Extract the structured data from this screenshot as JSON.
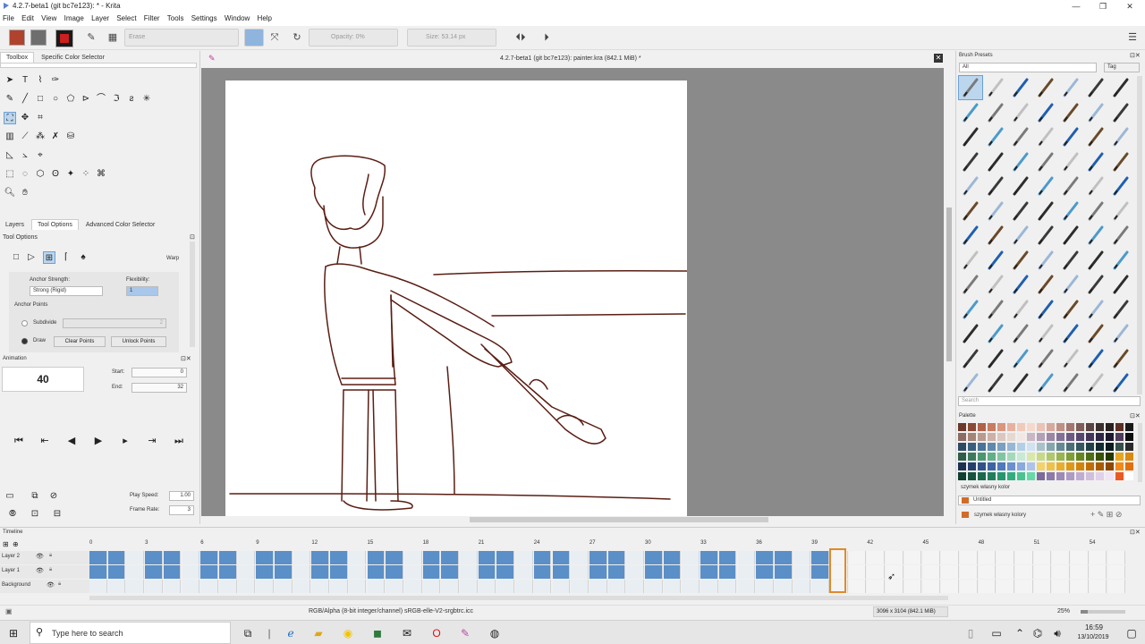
{
  "window": {
    "title": "4.2.7-beta1 (git bc7e123): * - Krita",
    "minimize": "—",
    "maximize": "❐",
    "close": "✕"
  },
  "menu": [
    "File",
    "Edit",
    "View",
    "Image",
    "Layer",
    "Select",
    "Filter",
    "Tools",
    "Settings",
    "Window",
    "Help"
  ],
  "toolbar": {
    "blend_mode": "Erase",
    "opacity": "Opacity: 0%",
    "size": "Size: 53.14 px",
    "colors": {
      "fg": "#b0432e",
      "bg": "#6e6e6e"
    }
  },
  "left_tabs": [
    "Toolbox",
    "Specific Color Selector"
  ],
  "lower_tabs": [
    "Layers",
    "Tool Options",
    "Advanced Color Selector"
  ],
  "tool_options": {
    "header": "Tool Options",
    "warp": "Warp",
    "anchor_strength_label": "Anchor Strength:",
    "anchor_strength_value": "Strong (Rigid)",
    "flexibility_label": "Flexibility:",
    "flexibility_value": "1",
    "anchor_points_label": "Anchor Points",
    "subdivide_label": "Subdivide",
    "subdivide_value": "2",
    "draw_label": "Draw",
    "clear_points": "Clear Points",
    "unlock_points": "Unlock Points"
  },
  "animation": {
    "header": "Animation",
    "current_frame": "40",
    "start_label": "Start:",
    "start_value": "0",
    "end_label": "End:",
    "end_value": "32",
    "play_speed_label": "Play Speed:",
    "play_speed_value": "1.00",
    "frame_rate_label": "Frame Rate:",
    "frame_rate_value": "3"
  },
  "canvas": {
    "header": "4.2.7-beta1 (git bc7e123): painter.kra (842.1 MiB) *"
  },
  "brush_presets": {
    "header": "Brush Presets",
    "filter": "All",
    "tag": "Tag",
    "search_placeholder": "Search"
  },
  "palette": {
    "header": "Palette",
    "name": "szymek własny kolor",
    "untitled": "Untitled",
    "entry": "szymek własny kolory"
  },
  "timeline": {
    "header": "Timeline",
    "ruler": [
      "0",
      "3",
      "6",
      "9",
      "12",
      "15",
      "18",
      "21",
      "24",
      "27",
      "30",
      "33",
      "36",
      "39",
      "42",
      "45",
      "48",
      "51",
      "54"
    ],
    "layers": [
      "Layer 2",
      "Layer 1",
      "Background"
    ]
  },
  "status": {
    "colorspace": "RGB/Alpha (8-bit integer/channel)  sRGB-elle-V2-srgbtrc.icc",
    "dimensions": "3096 x 3104 (842.1 MiB)",
    "zoom": "25%"
  },
  "taskbar": {
    "search_placeholder": "Type here to search",
    "time": "16:59",
    "date": "13/10/2019"
  }
}
